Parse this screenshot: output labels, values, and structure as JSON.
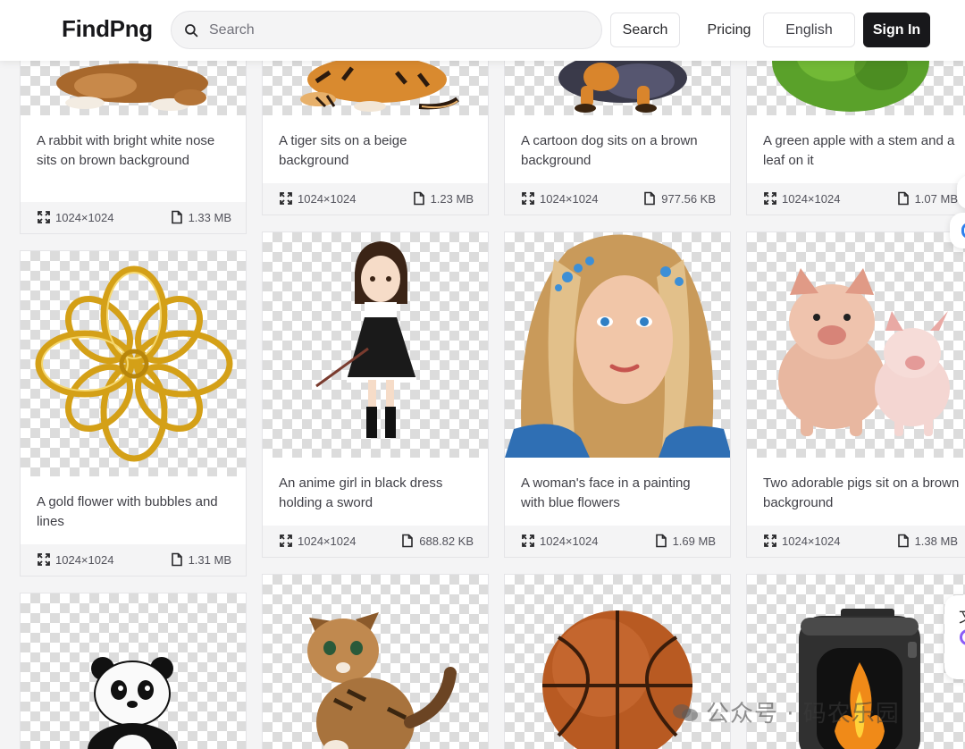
{
  "header": {
    "logo": "FindPng",
    "search_placeholder": "Search",
    "search_button": "Search",
    "pricing": "Pricing",
    "language": "English",
    "sign_in": "Sign In"
  },
  "cards": [
    {
      "title": "A rabbit with bright white nose sits on brown background",
      "dimensions": "1024×1024",
      "size": "1.33 MB"
    },
    {
      "title": "A tiger sits on a beige background",
      "dimensions": "1024×1024",
      "size": "1.23 MB"
    },
    {
      "title": "A cartoon dog sits on a brown background",
      "dimensions": "1024×1024",
      "size": "977.56 KB"
    },
    {
      "title": "A green apple with a stem and a leaf on it",
      "dimensions": "1024×1024",
      "size": "1.07 MB"
    },
    {
      "title": "A gold flower with bubbles and lines",
      "dimensions": "1024×1024",
      "size": "1.31 MB"
    },
    {
      "title": "An anime girl in black dress holding a sword",
      "dimensions": "1024×1024",
      "size": "688.82 KB"
    },
    {
      "title": "A woman's face in a painting with blue flowers",
      "dimensions": "1024×1024",
      "size": "1.69 MB"
    },
    {
      "title": "Two adorable pigs sit on a brown background",
      "dimensions": "1024×1024",
      "size": "1.38 MB"
    }
  ],
  "watermark": "公众号 · 码农乐园",
  "colors": {
    "accent": "#18181b",
    "card_meta_bg": "#f4f4f5",
    "checker": "#dcdcdc"
  },
  "icons": {
    "search": "search-icon",
    "dimensions": "expand-icon",
    "file": "file-icon"
  }
}
